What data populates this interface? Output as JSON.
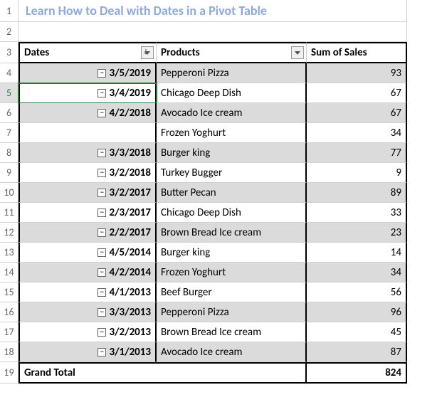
{
  "title": "Learn How to Deal with Dates in a Pivot Table",
  "row_numbers": [
    1,
    2,
    3,
    4,
    5,
    6,
    7,
    8,
    9,
    10,
    11,
    12,
    13,
    14,
    15,
    16,
    17,
    18,
    19
  ],
  "headers": {
    "dates": "Dates",
    "products": "Products",
    "sum": "Sum of Sales"
  },
  "rows": [
    {
      "date": "3/5/2019",
      "product": "Pepperoni Pizza",
      "sales": 93,
      "band": true,
      "collapse": true
    },
    {
      "date": "3/4/2019",
      "product": "Chicago Deep Dish",
      "sales": 67,
      "band": false,
      "collapse": true,
      "selected": true
    },
    {
      "date": "4/2/2018",
      "product": "Avocado Ice cream",
      "sales": 67,
      "band": true,
      "collapse": true
    },
    {
      "date": "",
      "product": "Frozen Yoghurt",
      "sales": 34,
      "band": false,
      "collapse": false
    },
    {
      "date": "3/3/2018",
      "product": "Burger king",
      "sales": 77,
      "band": true,
      "collapse": true
    },
    {
      "date": "3/2/2018",
      "product": "Turkey Bugger",
      "sales": 9,
      "band": false,
      "collapse": true
    },
    {
      "date": "3/2/2017",
      "product": "Butter Pecan",
      "sales": 89,
      "band": true,
      "collapse": true
    },
    {
      "date": "2/3/2017",
      "product": "Chicago Deep Dish",
      "sales": 33,
      "band": false,
      "collapse": true
    },
    {
      "date": "2/2/2017",
      "product": "Brown Bread Ice cream",
      "sales": 23,
      "band": true,
      "collapse": true
    },
    {
      "date": "4/5/2014",
      "product": "Burger king",
      "sales": 14,
      "band": false,
      "collapse": true
    },
    {
      "date": "4/2/2014",
      "product": "Frozen Yoghurt",
      "sales": 34,
      "band": true,
      "collapse": true
    },
    {
      "date": "4/1/2013",
      "product": "Beef Burger",
      "sales": 56,
      "band": false,
      "collapse": true
    },
    {
      "date": "3/3/2013",
      "product": "Pepperoni Pizza",
      "sales": 96,
      "band": true,
      "collapse": true
    },
    {
      "date": "3/2/2013",
      "product": "Brown Bread Ice cream",
      "sales": 45,
      "band": false,
      "collapse": true
    },
    {
      "date": "3/1/2013",
      "product": "Avocado Ice cream",
      "sales": 87,
      "band": true,
      "collapse": true
    }
  ],
  "total": {
    "label": "Grand Total",
    "value": 824
  }
}
